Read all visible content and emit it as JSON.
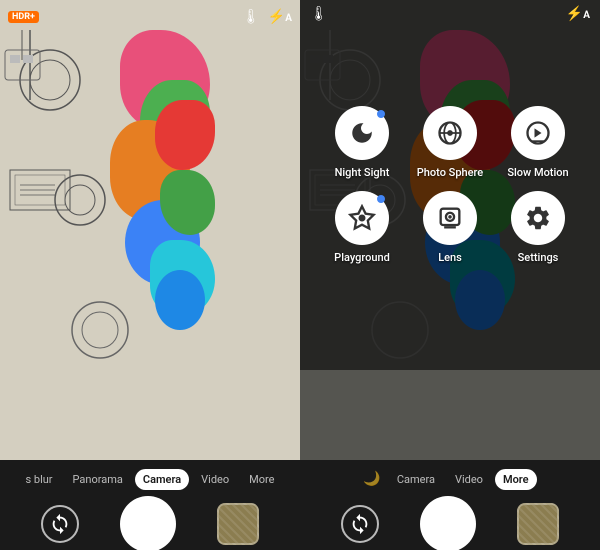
{
  "left_panel": {
    "top_bar": {
      "hdr_label": "HDR+",
      "temp_icon": "🌡",
      "flash_icon": "⚡",
      "flash_label": "A"
    },
    "mode_tabs": [
      "s blur",
      "Panorama",
      "Camera",
      "Video",
      "More"
    ],
    "active_tab": "Camera",
    "controls": {
      "rotate_icon": "↺",
      "gallery_alt": "gallery thumbnail"
    }
  },
  "right_panel": {
    "top_bar": {
      "temp_icon": "🌡",
      "flash_icon": "⚡",
      "flash_label": "A"
    },
    "mode_menu": {
      "items": [
        {
          "id": "night-sight",
          "label": "Night Sight",
          "icon": "☽",
          "has_dot": true
        },
        {
          "id": "photo-sphere",
          "label": "Photo Sphere",
          "icon": "◉",
          "has_dot": false
        },
        {
          "id": "slow-motion",
          "label": "Slow Motion",
          "icon": "⚙",
          "has_dot": false
        },
        {
          "id": "playground",
          "label": "Playground",
          "icon": "✦",
          "has_dot": true
        },
        {
          "id": "lens",
          "label": "Lens",
          "icon": "⬡",
          "has_dot": false
        },
        {
          "id": "settings",
          "label": "Settings",
          "icon": "⚙",
          "has_dot": false
        }
      ]
    },
    "mode_tabs": [
      "Camera",
      "Video",
      "More"
    ],
    "active_tab": "More"
  }
}
